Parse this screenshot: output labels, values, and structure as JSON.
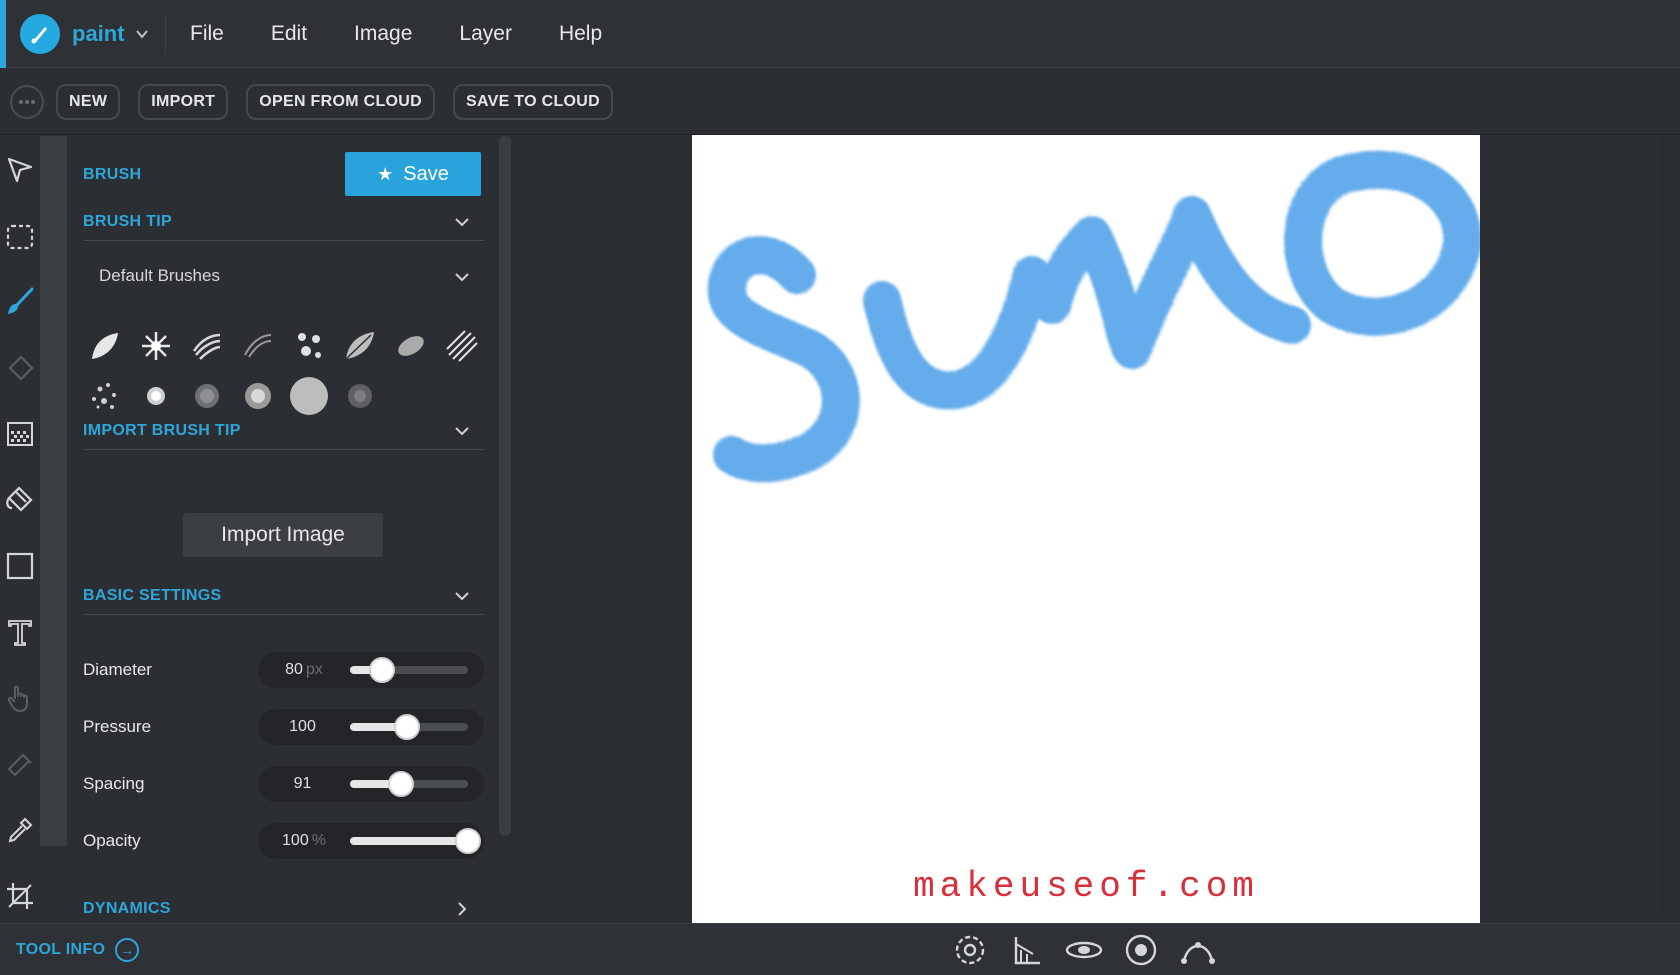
{
  "app": {
    "name": "paint",
    "accent": "#2ea6da"
  },
  "menu": {
    "items": [
      "File",
      "Edit",
      "Image",
      "Layer",
      "Help"
    ]
  },
  "toolbar": {
    "new_label": "NEW",
    "import_label": "IMPORT",
    "open_cloud_label": "OPEN FROM CLOUD",
    "save_cloud_label": "SAVE TO CLOUD"
  },
  "tools": [
    "select-arrow-icon",
    "marquee-icon",
    "brush-icon",
    "eraser-icon",
    "pattern-icon",
    "bucket-icon",
    "rectangle-icon",
    "text-icon",
    "hand-icon",
    "smudge-icon",
    "eyedropper-icon",
    "crop-icon"
  ],
  "panel": {
    "brush_title": "BRUSH",
    "save_label": "Save",
    "brush_tip_title": "BRUSH TIP",
    "brush_set": "Default Brushes",
    "import_tip_title": "IMPORT BRUSH TIP",
    "import_image_label": "Import Image",
    "basic_settings_title": "BASIC SETTINGS",
    "dynamics_title": "DYNAMICS",
    "settings": [
      {
        "label": "Diameter",
        "value": "80",
        "unit": "px",
        "fraction": 0.27
      },
      {
        "label": "Pressure",
        "value": "100",
        "unit": "",
        "fraction": 0.48
      },
      {
        "label": "Spacing",
        "value": "91",
        "unit": "",
        "fraction": 0.43
      },
      {
        "label": "Opacity",
        "value": "100",
        "unit": "%",
        "fraction": 1.0
      }
    ]
  },
  "canvas": {
    "watermark": "makeuseof.com",
    "stroke_color": "#4a9ee8"
  },
  "bottom": {
    "tool_info_label": "TOOL INFO"
  }
}
